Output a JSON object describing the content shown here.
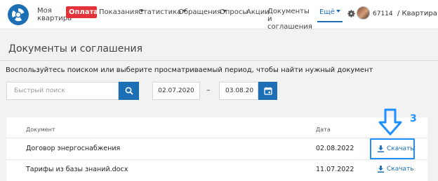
{
  "nav": {
    "brand_label": "Моя квартира",
    "pay_label": "Оплата",
    "meters_label": "Показания",
    "stats_label": "Статистика",
    "requests_label": "Обращения",
    "polls_label": "Опросы",
    "promos_label": "Акции",
    "documents_label": "Документы и соглашения",
    "more_label": "Ещё",
    "user_id": "67114",
    "apartment_label": "/ Квартира",
    "accent_color": "#1d6fb5",
    "pay_color": "#e2323a"
  },
  "page": {
    "title": "Документы и соглашения",
    "hint": "Воспользуйтесь поиском или выберите просматриваемый период, чтобы найти нужный документ"
  },
  "filters": {
    "search_placeholder": "Быстрый поиск",
    "date_from": "02.07.2020",
    "date_separator": "–",
    "date_to": "03.08.20"
  },
  "table": {
    "col_document": "Документ",
    "col_date": "Дата",
    "rows": [
      {
        "name": "Договор энергоснабжения",
        "date": "02.08.2022",
        "action": "Скачать"
      },
      {
        "name": "Тарифы из базы знаний.docx",
        "date": "11.07.2022",
        "action": "Скачать"
      }
    ]
  },
  "annotation": {
    "step_number": "3",
    "color": "#1e90ff"
  }
}
